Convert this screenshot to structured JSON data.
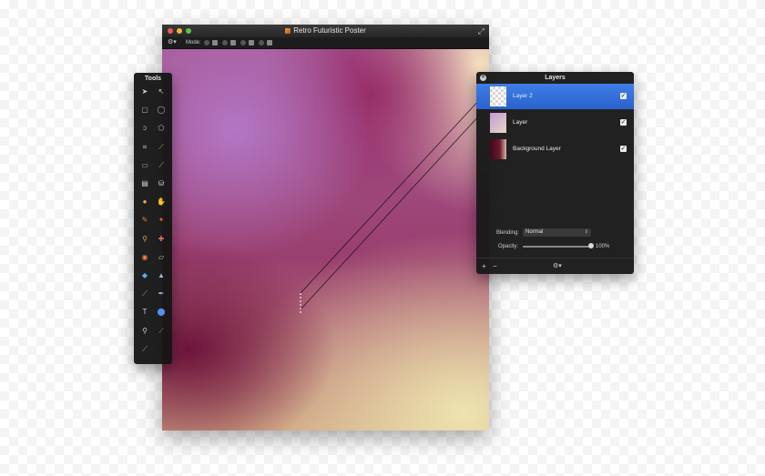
{
  "document": {
    "title": "Retro Futuristic Poster",
    "toolbar": {
      "mode_label": "Mode:"
    }
  },
  "tools": {
    "title": "Tools",
    "items": [
      "select-arrow-icon",
      "direct-select-icon",
      "rect-select-icon",
      "ellipse-select-icon",
      "lasso-icon",
      "polygon-lasso-icon",
      "crop-icon",
      "eyedropper-icon",
      "eraser-icon",
      "brush-icon",
      "gradient-icon",
      "paint-bucket-icon",
      "sponge-icon",
      "smudge-icon",
      "dodge-icon",
      "burn-icon",
      "clone-stamp-icon",
      "heal-icon",
      "red-eye-icon",
      "blur-icon",
      "droplet-icon",
      "sharpen-icon",
      "pen-icon",
      "vector-pen-icon",
      "text-icon",
      "shape-icon",
      "zoom-icon",
      "pencil-icon",
      "line-icon"
    ]
  },
  "layers": {
    "title": "Layers",
    "items": [
      {
        "name": "Layer 2",
        "selected": true,
        "thumb": "checker"
      },
      {
        "name": "Layer",
        "selected": false,
        "thumb": "purple"
      },
      {
        "name": "Background Layer",
        "selected": false,
        "thumb": "bg"
      }
    ],
    "blending_label": "Blending:",
    "blending_value": "Normal",
    "opacity_label": "Opacity:",
    "opacity_value": "100%",
    "opacity_fraction": 1.0
  },
  "colors": {
    "selection_blue": "#2f6fdc",
    "window_dark": "#1f1f1f"
  }
}
